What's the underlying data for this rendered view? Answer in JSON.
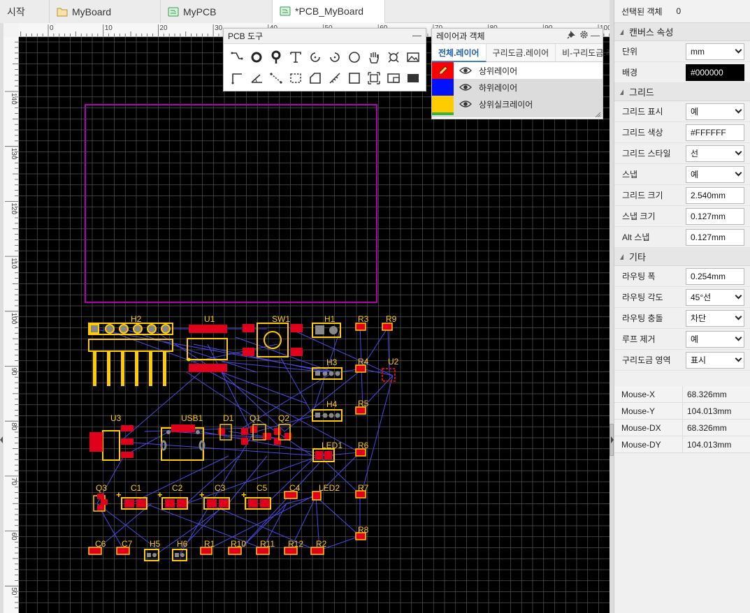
{
  "tabs": [
    {
      "label": "시작",
      "icon": "none"
    },
    {
      "label": "MyBoard",
      "icon": "folder-icon"
    },
    {
      "label": "MyPCB",
      "icon": "pcb-file-icon"
    },
    {
      "label": "*PCB_MyBoard",
      "icon": "pcb-file-icon",
      "active": true
    }
  ],
  "rulers": {
    "top_labels": [
      "0",
      "10",
      "20",
      "30",
      "40",
      "50",
      "60",
      "70",
      "80",
      "90",
      "100"
    ],
    "left_labels": [
      "140",
      "130",
      "120",
      "110",
      "100",
      "90",
      "80",
      "70",
      "60",
      "50"
    ]
  },
  "pcb_tools": {
    "title": "PCB 도구",
    "icons": [
      "wire-icon",
      "via-icon",
      "pad-icon",
      "text-icon",
      "arc-icon",
      "arc-ccw-icon",
      "circle-icon",
      "pan-hand-icon",
      "drc-icon",
      "image-icon",
      "line-icon",
      "angle-icon",
      "dimension-icon",
      "region-icon",
      "board-outline-icon",
      "measure-icon",
      "rectangle-icon",
      "select-icon",
      "component-icon",
      "fill-icon"
    ]
  },
  "layers_panel": {
    "title": "레이어과 객체",
    "tabs": [
      "전체.레이어",
      "구리도금.레이어",
      "비-구리도금.레"
    ],
    "layers": [
      {
        "name": "상위레이어",
        "color": "#FF0000",
        "editing": true
      },
      {
        "name": "하위레이어",
        "color": "#0011FF",
        "editing": false
      },
      {
        "name": "상위실크레이어",
        "color": "#FFCC00",
        "editing": false
      }
    ]
  },
  "properties": {
    "selected_label": "선택된 객체",
    "selected_count": "0",
    "canvas_section": "캔버스 속성",
    "unit_label": "단위",
    "unit_value": "mm",
    "bg_label": "배경",
    "bg_value": "#000000",
    "grid_section": "그리드",
    "grid_show_label": "그리드 표시",
    "grid_show_value": "예",
    "grid_color_label": "그리드 색상",
    "grid_color_value": "#FFFFFF",
    "grid_style_label": "그리드 스타일",
    "grid_style_value": "선",
    "snap_label": "스냅",
    "snap_value": "예",
    "grid_size_label": "그리드 크기",
    "grid_size_value": "2.540mm",
    "snap_size_label": "스냅 크기",
    "snap_size_value": "0.127mm",
    "alt_snap_label": "Alt 스냅",
    "alt_snap_value": "0.127mm",
    "other_section": "기타",
    "route_width_label": "라우팅 폭",
    "route_width_value": "0.254mm",
    "route_angle_label": "라우팅 각도",
    "route_angle_value": "45°선",
    "route_conflict_label": "라우팅 충돌",
    "route_conflict_value": "차단",
    "loop_label": "루프 제거",
    "loop_value": "예",
    "copper_area_label": "구리도금 영역",
    "copper_area_value": "표시"
  },
  "mouse": [
    {
      "label": "Mouse-X",
      "value": "68.326mm"
    },
    {
      "label": "Mouse-Y",
      "value": "104.013mm"
    },
    {
      "label": "Mouse-DX",
      "value": "68.326mm"
    },
    {
      "label": "Mouse-DY",
      "value": "104.013mm"
    }
  ],
  "designators": [
    "H2",
    "U1",
    "SW1",
    "H1",
    "R3",
    "R9",
    "H3",
    "R4",
    "U2",
    "H4",
    "R5",
    "U3",
    "USB1",
    "D1",
    "Q1",
    "Q2",
    "LED1",
    "R6",
    "Q3",
    "C1",
    "C2",
    "C3",
    "C5",
    "C4",
    "LED2",
    "R7",
    "R8",
    "C6",
    "C7",
    "H5",
    "H6",
    "R1",
    "R10",
    "R11",
    "R12",
    "R2"
  ],
  "colors": {
    "board_outline": "#B400B4",
    "silk": "#FFCC00",
    "top_copper": "#E0001B",
    "ratsnest": "#4A4AE8",
    "grid": "#555555"
  }
}
